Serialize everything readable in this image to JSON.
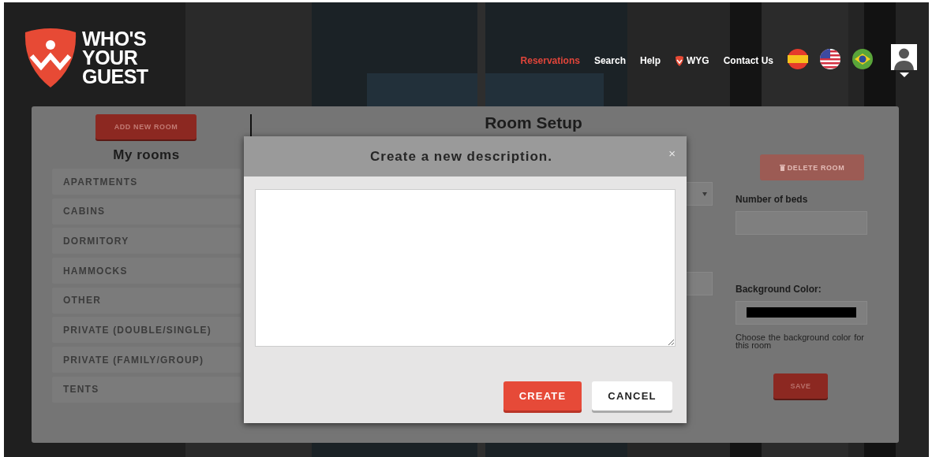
{
  "header": {
    "logo_lines": [
      "WHO'S",
      "YOUR",
      "GUEST"
    ],
    "nav": [
      {
        "label": "Reservations",
        "selected": true,
        "kind": "text"
      },
      {
        "label": "Search",
        "selected": false,
        "kind": "text"
      },
      {
        "label": "Help",
        "selected": false,
        "kind": "text"
      },
      {
        "label": "WYG",
        "selected": false,
        "kind": "shield"
      },
      {
        "label": "Contact Us",
        "selected": false,
        "kind": "text"
      }
    ],
    "languages": [
      {
        "kind": "es"
      },
      {
        "kind": "us"
      },
      {
        "kind": "br"
      }
    ]
  },
  "sidebar": {
    "add_button": "ADD NEW ROOM",
    "title": "My rooms",
    "rooms": [
      "APARTMENTS",
      "CABINS",
      "DORMITORY",
      "HAMMOCKS",
      "OTHER",
      "PRIVATE (DOUBLE/SINGLE)",
      "PRIVATE (FAMILY/GROUP)",
      "TENTS"
    ]
  },
  "room_setup": {
    "title": "Room Setup",
    "delete_button": "DELETE ROOM",
    "beds_label": "Number of beds",
    "color_label": "Background Color:",
    "color": "#000000",
    "color_hint": "Choose the background color for this room",
    "save_button": "SAVE"
  },
  "modal": {
    "title": "Create a new description.",
    "close": "×",
    "buttons": [
      {
        "label": "CREATE",
        "kind": "primary"
      },
      {
        "label": "CANCEL",
        "kind": "secondary"
      }
    ]
  }
}
